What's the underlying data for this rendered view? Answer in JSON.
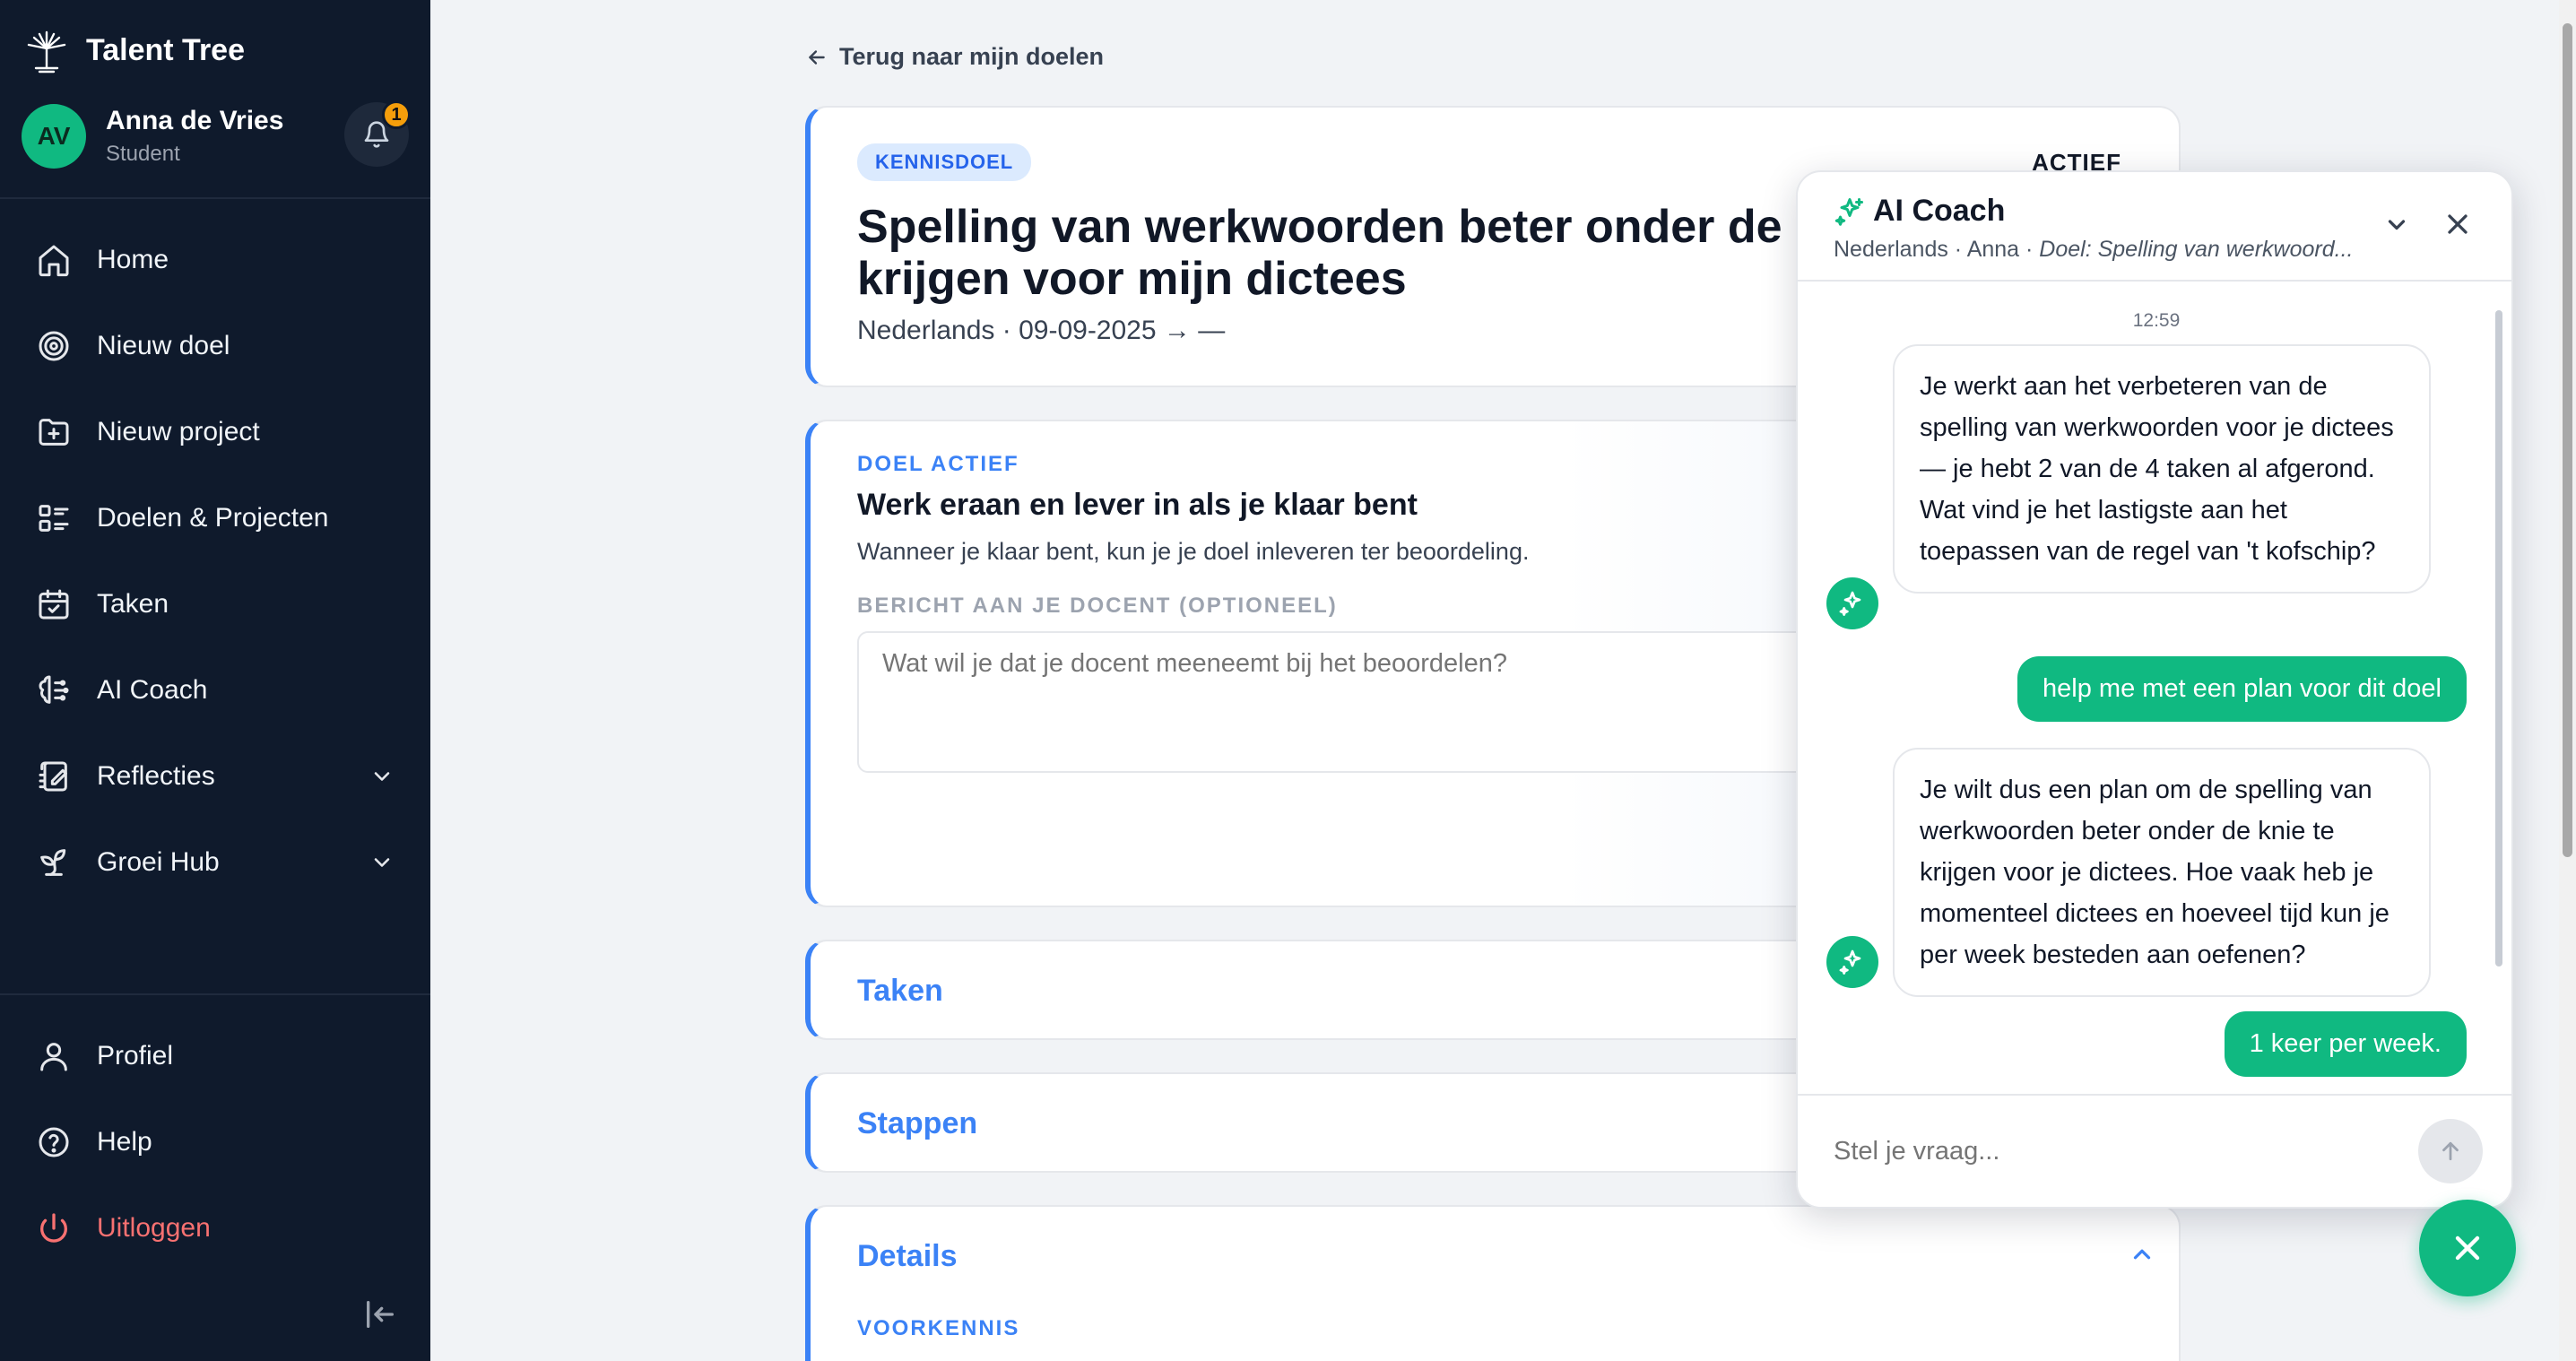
{
  "app": {
    "name": "Talent Tree"
  },
  "user": {
    "initials": "AV",
    "name": "Anna de Vries",
    "role": "Student",
    "notifications": "1"
  },
  "sidebar": {
    "items": [
      {
        "label": "Home",
        "icon": "home-icon"
      },
      {
        "label": "Nieuw doel",
        "icon": "target-icon"
      },
      {
        "label": "Nieuw project",
        "icon": "folder-plus-icon"
      },
      {
        "label": "Doelen & Projecten",
        "icon": "list-icon"
      },
      {
        "label": "Taken",
        "icon": "calendar-check-icon"
      },
      {
        "label": "AI Coach",
        "icon": "brain-icon"
      },
      {
        "label": "Reflecties",
        "icon": "edit-icon"
      },
      {
        "label": "Groei Hub",
        "icon": "sprout-icon"
      }
    ],
    "bottom": [
      {
        "label": "Profiel",
        "icon": "user-icon"
      },
      {
        "label": "Help",
        "icon": "help-icon"
      },
      {
        "label": "Uitloggen",
        "icon": "power-icon"
      }
    ]
  },
  "main": {
    "back_label": "Terug naar mijn doelen",
    "goal": {
      "tag": "KENNISDOEL",
      "status": "ACTIEF",
      "title": "Spelling van werkwoorden beter onder de knie krijgen voor mijn dictees",
      "meta": "Nederlands · 09-09-2025 → —"
    },
    "active": {
      "eyebrow": "DOEL ACTIEF",
      "title": "Werk eraan en lever in als je klaar bent",
      "subtitle": "Wanneer je klaar bent, kun je je doel inleveren ter beoordeling.",
      "field_label": "BERICHT AAN JE DOCENT (OPTIONEEL)",
      "placeholder": "Wat wil je dat je docent meeneemt bij het beoordelen?"
    },
    "sections": {
      "taken": "Taken",
      "stappen": "Stappen",
      "details": "Details",
      "voorkennis": "VOORKENNIS"
    }
  },
  "chat": {
    "title": "AI Coach",
    "context_prefix": "Nederlands · Anna · ",
    "context_goal": "Doel: Spelling van werkwoord...",
    "timestamp": "12:59",
    "messages": [
      {
        "role": "ai",
        "text": "Je werkt aan het verbeteren van de spelling van werkwoorden voor je dictees — je hebt 2 van de 4 taken al afgerond. Wat vind je het lastigste aan het toepassen van de regel van 't kofschip?"
      },
      {
        "role": "user",
        "text": "help me met een plan voor dit doel"
      },
      {
        "role": "ai",
        "text": "Je wilt dus een plan om de spelling van werkwoorden beter onder de knie te krijgen voor je dictees. Hoe vaak heb je momenteel dictees en hoeveel tijd kun je per week besteden aan oefenen?"
      },
      {
        "role": "user",
        "text": "1 keer per week."
      }
    ],
    "input_placeholder": "Stel je vraag..."
  },
  "colors": {
    "sidebar_bg": "#0f1a2c",
    "accent": "#3b82f6",
    "green": "#10b981",
    "logout": "#f87171",
    "badge": "#f59e0b"
  }
}
